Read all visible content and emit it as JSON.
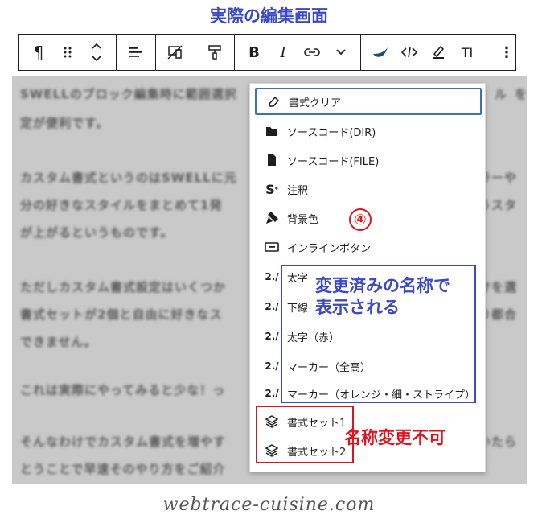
{
  "title": "実際の編集画面",
  "toolbar": {
    "paragraph": "¶",
    "bold": "B",
    "italic": "I",
    "text_size": "TI",
    "more": "⋮"
  },
  "editor_lines": [
    "SWELLのブロック編集時に範囲選択",
    "定が便利です。",
    "カスタム書式というのはSWELLに元",
    "分の好きなスタイルをまとめて1発",
    "が上がるというものです。",
    "ただしカスタム書式設定はいくつか",
    "書式セットが2個と自由に好きなス",
    "できません。",
    "これは実際にやってみると少な！っ",
    "そんなわけでカスタム書式を増やす",
    "とうことで早速そのやり方をご紹介"
  ],
  "editor_right": {
    "line1": "ル",
    "line1b": "を",
    "line3": "ラーや",
    "line4": "うスタ",
    "line6": "けを選",
    "line7": "り都合",
    "line10": "いたら"
  },
  "menu": [
    {
      "label": "書式クリア",
      "icon": "eraser-icon"
    },
    {
      "label": "ソースコード(DIR)",
      "icon": "folder-icon"
    },
    {
      "label": "ソースコード(FILE)",
      "icon": "file-icon"
    },
    {
      "label": "注釈",
      "icon": "superscript-s-icon"
    },
    {
      "label": "背景色",
      "icon": "paint-brush-icon"
    },
    {
      "label": "インラインボタン",
      "icon": "inline-button-icon"
    },
    {
      "label": "太字",
      "icon": "custom-format-icon"
    },
    {
      "label": "下線",
      "icon": "custom-format-icon"
    },
    {
      "label": "太字（赤）",
      "icon": "custom-format-icon"
    },
    {
      "label": "マーカー（全高）",
      "icon": "custom-format-icon"
    },
    {
      "label": "マーカー（オレンジ・細・ストライプ）",
      "icon": "custom-format-icon"
    },
    {
      "label": "書式セット1",
      "icon": "layers-icon"
    },
    {
      "label": "書式セット2",
      "icon": "layers-icon"
    }
  ],
  "annotations": {
    "circle_number": "④",
    "blue_line1": "変更済みの名称で",
    "blue_line2": "表示される",
    "red_text": "名称変更不可"
  },
  "footer": "webtrace-cuisine.com",
  "colors": {
    "annotation_blue": "#3b49c8",
    "annotation_red": "#e0141e",
    "focus_border": "#3a73b8"
  }
}
